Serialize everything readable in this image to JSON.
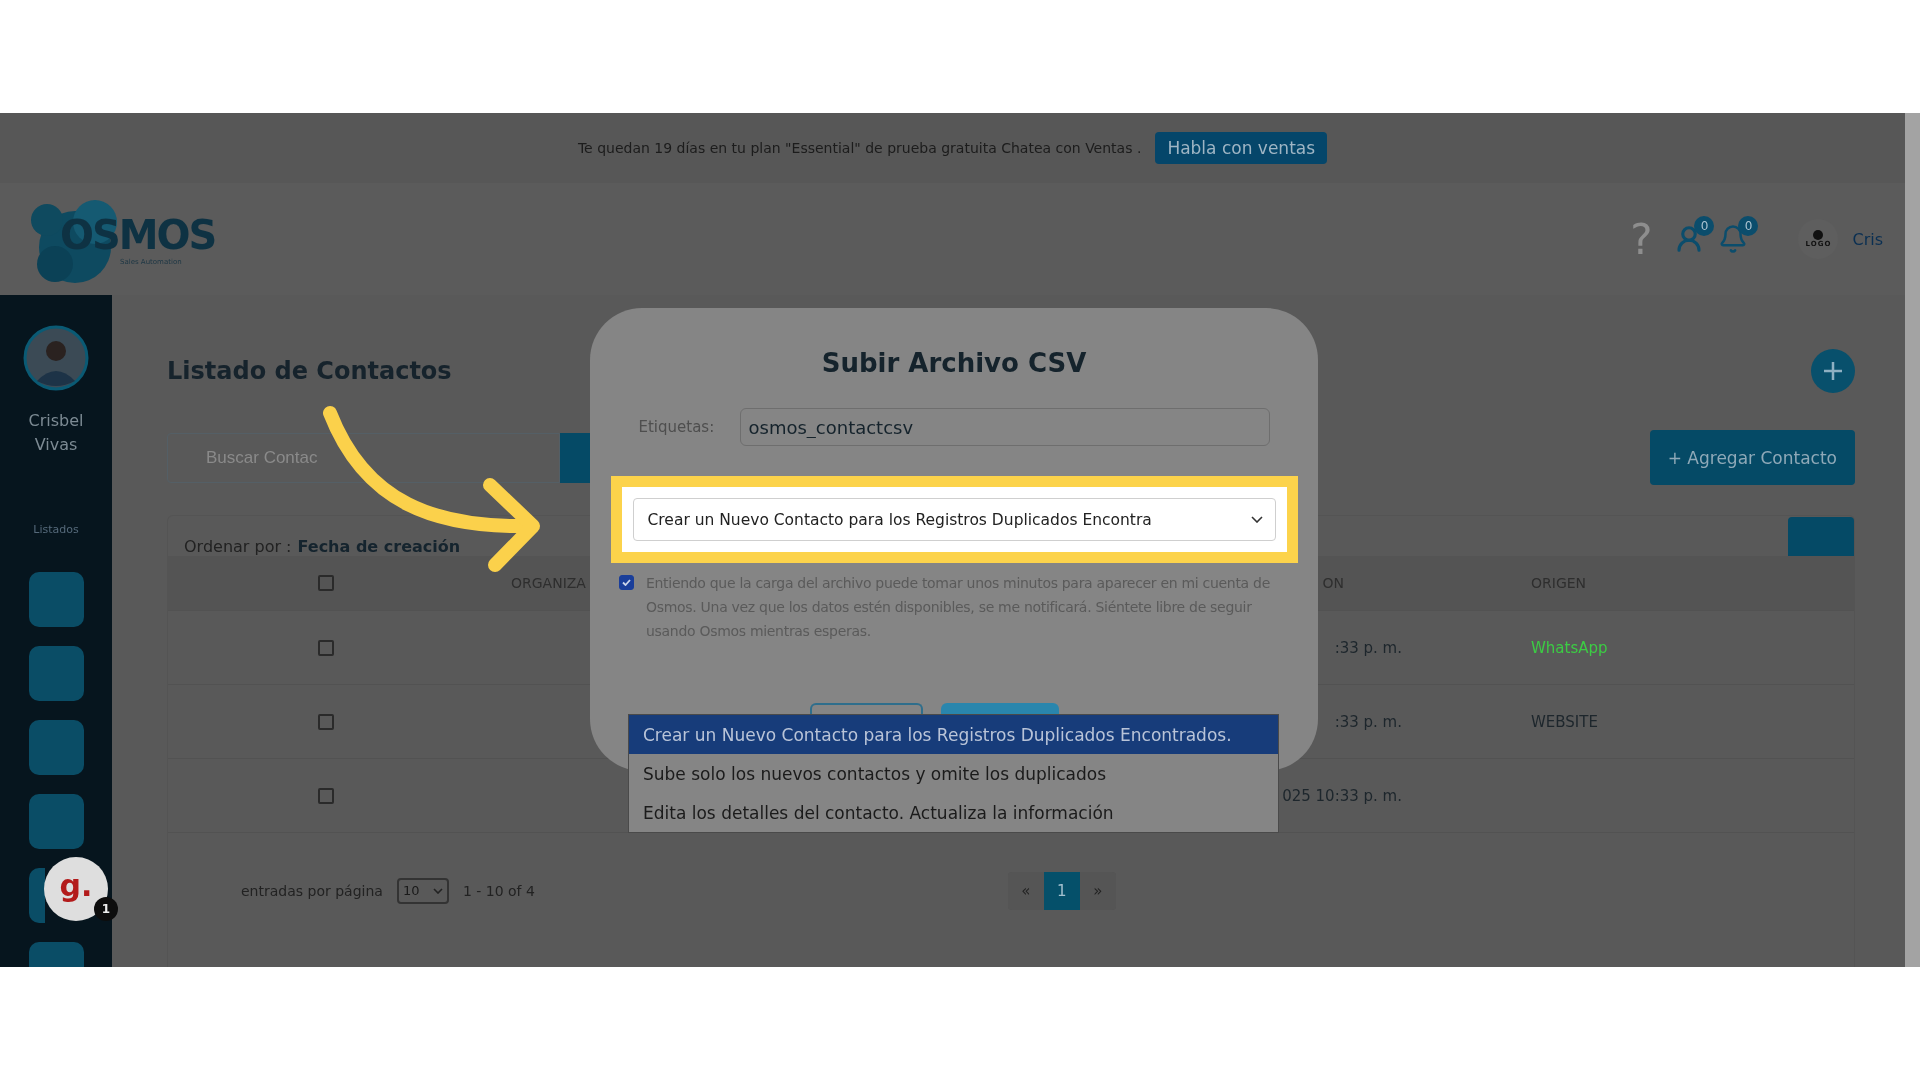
{
  "banner": {
    "text": "Te quedan 19 días en tu plan \"Essential\" de prueba gratuita Chatea con Ventas .",
    "button": "Habla con ventas"
  },
  "header": {
    "logo": {
      "name": "OSMOS",
      "tagline": "Sales Automation"
    },
    "help": "?",
    "contacts_badge": "0",
    "notifications_badge": "0",
    "account_logo": "LOGO",
    "user": "Cris"
  },
  "sidebar": {
    "user_name": "Crisbel Vivas",
    "section": "Listados"
  },
  "page": {
    "title": "Listado de Contactos",
    "search": {
      "placeholder": "Buscar Contac"
    },
    "add_button": "+ Agregar Contacto",
    "sort": {
      "label": "Ordenar por :",
      "value": "Fecha de creación"
    },
    "table": {
      "columns": [
        "ORGANIZA",
        "ON",
        "ORIGEN"
      ],
      "header_checked": false,
      "rows": [
        {
          "checked": false,
          "date": ":33 p. m.",
          "origin": "WhatsApp",
          "color": "#3ccc44"
        },
        {
          "checked": false,
          "date": ":33 p. m.",
          "origin": "WEBSITE",
          "color": "#1d262c"
        },
        {
          "checked": false,
          "date": "025 10:33 p. m."
        }
      ]
    },
    "footer": {
      "per_page_label": "entradas por página",
      "per_page": "10",
      "range": "1 - 10 of 4"
    },
    "pagination": [
      {
        "label": "«",
        "selected": false
      },
      {
        "label": "1",
        "selected": true
      },
      {
        "label": "»",
        "selected": false
      }
    ]
  },
  "chat_widget": {
    "letter": "g.",
    "badge": "1"
  },
  "modal": {
    "title": "Subir Archivo CSV",
    "tags_label": "Etiquetas:",
    "tags_value": "osmos_contactcsv",
    "mode_select": "Crear un Nuevo Contacto para los Registros Duplicados Encontra",
    "consent": {
      "checked": true,
      "text": "Entiendo que la carga del archivo puede tomar unos minutos para aparecer en mi cuenta de Osmos. Una vez que los datos estén disponibles, se me notificará. Siéntete libre de seguir usando Osmos mientras esperas."
    },
    "options": [
      {
        "label": "Crear un Nuevo Contacto para los Registros Duplicados Encontrados.",
        "selected": true
      },
      {
        "label": "Sube solo los nuevos contactos y omite los duplicados",
        "selected": false
      },
      {
        "label": "Edita los detalles del contacto. Actualiza la información",
        "selected": false
      }
    ]
  }
}
